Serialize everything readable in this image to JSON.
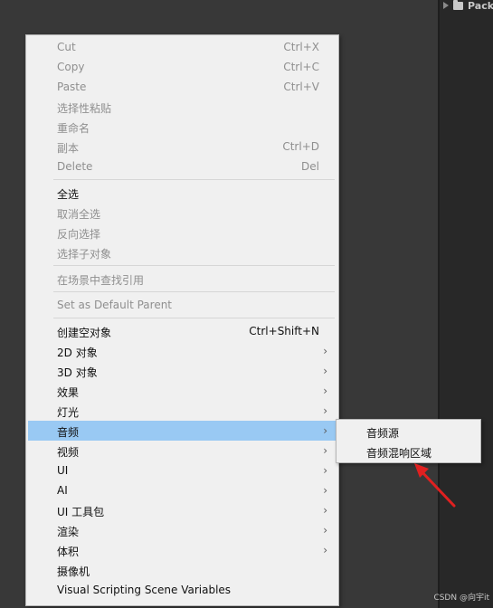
{
  "project_panel": {
    "item_label": "Pack"
  },
  "menu": {
    "groups": [
      [
        {
          "label": "Cut",
          "shortcut": "Ctrl+X",
          "enabled": false
        },
        {
          "label": "Copy",
          "shortcut": "Ctrl+C",
          "enabled": false
        },
        {
          "label": "Paste",
          "shortcut": "Ctrl+V",
          "enabled": false
        },
        {
          "label": "选择性粘贴",
          "shortcut": "",
          "enabled": false
        },
        {
          "label": "重命名",
          "shortcut": "",
          "enabled": false
        },
        {
          "label": "副本",
          "shortcut": "Ctrl+D",
          "enabled": false
        },
        {
          "label": "Delete",
          "shortcut": "Del",
          "enabled": false
        }
      ],
      [
        {
          "label": "全选",
          "shortcut": "",
          "enabled": true
        },
        {
          "label": "取消全选",
          "shortcut": "",
          "enabled": false
        },
        {
          "label": "反向选择",
          "shortcut": "",
          "enabled": false
        },
        {
          "label": "选择子对象",
          "shortcut": "",
          "enabled": false
        }
      ],
      [
        {
          "label": "在场景中查找引用",
          "shortcut": "",
          "enabled": false
        }
      ],
      [
        {
          "label": "Set as Default Parent",
          "shortcut": "",
          "enabled": false
        }
      ],
      [
        {
          "label": "创建空对象",
          "shortcut": "Ctrl+Shift+N",
          "enabled": true
        },
        {
          "label": "2D 对象",
          "submenu": true,
          "enabled": true
        },
        {
          "label": "3D 对象",
          "submenu": true,
          "enabled": true
        },
        {
          "label": "效果",
          "submenu": true,
          "enabled": true
        },
        {
          "label": "灯光",
          "submenu": true,
          "enabled": true
        },
        {
          "label": "音频",
          "submenu": true,
          "enabled": true,
          "highlighted": true
        },
        {
          "label": "视频",
          "submenu": true,
          "enabled": true
        },
        {
          "label": "UI",
          "submenu": true,
          "enabled": true
        },
        {
          "label": "AI",
          "submenu": true,
          "enabled": true
        },
        {
          "label": "UI 工具包",
          "submenu": true,
          "enabled": true
        },
        {
          "label": "渲染",
          "submenu": true,
          "enabled": true
        },
        {
          "label": "体积",
          "submenu": true,
          "enabled": true
        },
        {
          "label": "摄像机",
          "shortcut": "",
          "enabled": true
        },
        {
          "label": "Visual Scripting Scene Variables",
          "shortcut": "",
          "enabled": true
        }
      ]
    ]
  },
  "submenu": {
    "items": [
      {
        "label": "音频源"
      },
      {
        "label": "音频混响区域"
      }
    ]
  },
  "watermark": "CSDN @向宇it",
  "colors": {
    "highlight": "#99c9f3",
    "annotation_arrow": "#e02020",
    "menu_bg": "#f0f0f0"
  },
  "icons": {
    "submenu_arrow": "chevron-right-icon",
    "annotation": "red-arrow-icon"
  }
}
